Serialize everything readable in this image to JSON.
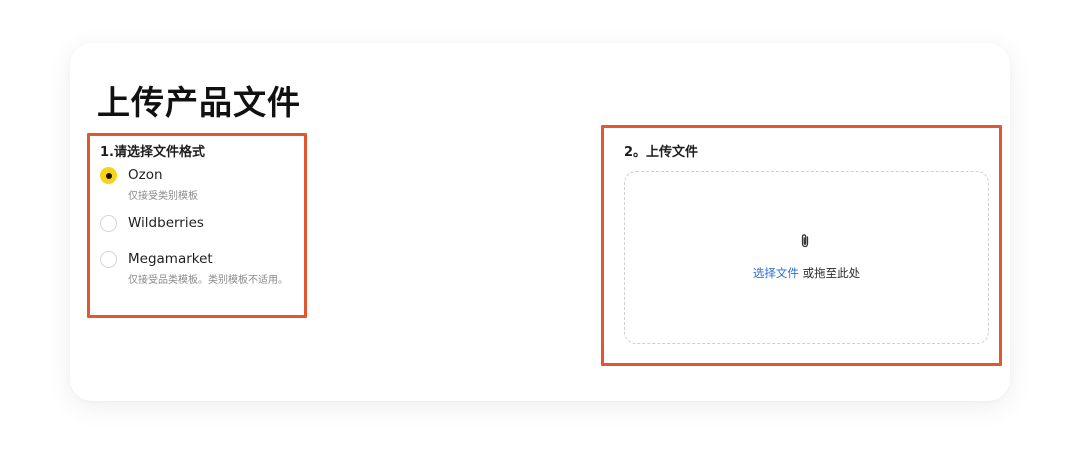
{
  "page": {
    "title": "上传产品文件"
  },
  "format_section": {
    "label": "1.请选择文件格式",
    "options": [
      {
        "label": "Ozon",
        "hint": "仅接受类别模板",
        "selected": true
      },
      {
        "label": "Wildberries",
        "hint": "",
        "selected": false
      },
      {
        "label": "Megamarket",
        "hint": "仅接受品类模板。类别模板不适用。",
        "selected": false
      }
    ]
  },
  "upload_section": {
    "label": "2。上传文件",
    "dropzone": {
      "icon": "paperclip-icon",
      "link_text": "选择文件",
      "rest_text": " 或拖至此处"
    }
  },
  "colors": {
    "highlight": "#e4572e",
    "radio_selected": "#fad21a",
    "link": "#2a6ed4"
  }
}
